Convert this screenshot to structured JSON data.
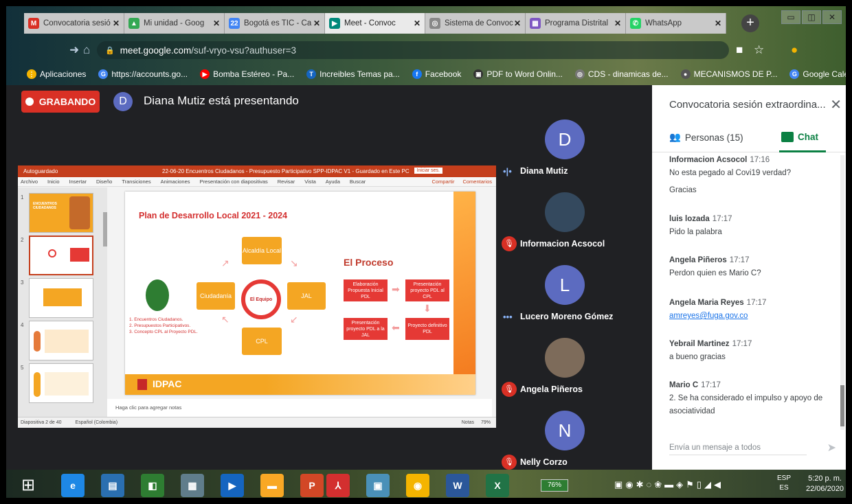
{
  "browser": {
    "tabs": [
      {
        "title": "Convocatoria sesió",
        "icon": "gmail-icon",
        "color": "#d93025",
        "glyph": "M"
      },
      {
        "title": "Mi unidad - Goog",
        "icon": "drive-icon",
        "color": "#34a853",
        "glyph": "▲"
      },
      {
        "title": "Bogotá es TIC - Ca",
        "icon": "calendar-icon",
        "color": "#4285f4",
        "glyph": "22"
      },
      {
        "title": "Meet - Convoc",
        "icon": "meet-icon",
        "color": "#00897b",
        "glyph": "▶"
      },
      {
        "title": "Sistema de Convoc",
        "icon": "globe-icon",
        "color": "#888888",
        "glyph": "◎"
      },
      {
        "title": "Programa Distrital",
        "icon": "calendar-icon",
        "color": "#7e57c2",
        "glyph": "▦"
      },
      {
        "title": "WhatsApp",
        "icon": "whatsapp-icon",
        "color": "#25d366",
        "glyph": "✆"
      }
    ],
    "url_host": "meet.google.com",
    "url_path": "/suf-vryo-vsu?authuser=3",
    "bookmarks": [
      {
        "label": "Aplicaciones",
        "color": "#f4b400",
        "glyph": "⋮"
      },
      {
        "label": "https://accounts.go...",
        "color": "#4285f4",
        "glyph": "G"
      },
      {
        "label": "Bomba Estéreo - Pa...",
        "color": "#ff0000",
        "glyph": "▶"
      },
      {
        "label": "Increibles Temas pa...",
        "color": "#1565c0",
        "glyph": "T"
      },
      {
        "label": "Facebook",
        "color": "#1877f2",
        "glyph": "f"
      },
      {
        "label": "PDF to Word Onlin...",
        "color": "#333333",
        "glyph": "▣"
      },
      {
        "label": "CDS - dinamicas de...",
        "color": "#777777",
        "glyph": "◎"
      },
      {
        "label": "MECANISMOS DE P...",
        "color": "#555555",
        "glyph": "●"
      },
      {
        "label": "Google Calendar",
        "color": "#4285f4",
        "glyph": "G"
      }
    ]
  },
  "meet": {
    "recording_label": "GRABANDO",
    "presenter_initial": "D",
    "presenter_text": "Diana Mutiz está presentando",
    "participants": [
      {
        "name": "Diana Mutiz",
        "initial": "D",
        "color": "#5c6bc0",
        "status": "speaking"
      },
      {
        "name": "Informacion Acsocol",
        "initial": "",
        "color": "#34495e",
        "status": "muted"
      },
      {
        "name": "Lucero Moreno Gómez",
        "initial": "L",
        "color": "#5c6bc0",
        "status": "speaking"
      },
      {
        "name": "Angela Piñeros",
        "initial": "",
        "color": "#7d6b5a",
        "status": "muted"
      },
      {
        "name": "Nelly Corzo",
        "initial": "N",
        "color": "#5c6bc0",
        "status": "muted"
      }
    ]
  },
  "ppt": {
    "autosave": "Autoguardado",
    "doc_title": "22-06-20 Encuentros Ciudadanos - Presupuesto Participativo SPP-IDPAC V1 - Guardado en Este PC",
    "share_label": "Iniciar ses.",
    "menu": [
      "Archivo",
      "Inicio",
      "Insertar",
      "Diseño",
      "Transiciones",
      "Animaciones",
      "Presentación con diapositivas",
      "Revisar",
      "Vista",
      "Ayuda",
      "Buscar"
    ],
    "menu_right": [
      "Compartir",
      "Comentarios"
    ],
    "thumb_numbers": [
      "1",
      "2",
      "3",
      "4",
      "5"
    ],
    "thumb1_text": "ENCUENTROS CIUDADANOS",
    "slide": {
      "title": "Plan de Desarrollo Local 2021 - 2024",
      "alcaldia": "Alcaldía Local",
      "ciudadania": "Ciudadanía",
      "jal": "JAL",
      "cpl": "CPL",
      "equipo": "El Equipo",
      "proceso": "El Proceso",
      "step1": "Elaboración Propuesta Inicial PDL",
      "step2": "Presentación proyecto PDL al CPL",
      "step3": "Proyecto definitivo PDL",
      "step4": "Presentación proyecto PDL a la JAL",
      "list": [
        "1. Encuentros Ciudadanos.",
        "2. Presupuestos Participativos.",
        "3. Concepto CPL al Proyecto PDL."
      ],
      "logo": "IDPAC"
    },
    "notes_placeholder": "Haga clic para agregar notas",
    "status_left": "Diapositiva 2 de 40",
    "status_lang": "Español (Colombia)",
    "status_notes": "Notas",
    "status_zoom": "79%"
  },
  "chat": {
    "title": "Convocatoria sesión extraordina...",
    "people_tab": "Personas (15)",
    "chat_tab": "Chat",
    "messages": [
      {
        "sender": "Informacion Acsocol",
        "time": "17:16",
        "lines": [
          "No esta pegado al Covi19 verdad?"
        ]
      },
      {
        "sender": "",
        "time": "",
        "lines": [
          "Gracias"
        ]
      },
      {
        "sender": "luis lozada",
        "time": "17:17",
        "lines": [
          "Pido la palabra"
        ]
      },
      {
        "sender": "Angela Piñeros",
        "time": "17:17",
        "lines": [
          "Perdon quien es Mario C?"
        ]
      },
      {
        "sender": "Angela Maria Reyes",
        "time": "17:17",
        "lines": [
          "amreyes@fuga.gov.co"
        ]
      },
      {
        "sender": "Yebrail Martinez",
        "time": "17:17",
        "lines": [
          "a bueno gracias"
        ]
      },
      {
        "sender": "Mario C",
        "time": "17:17",
        "lines": [
          "2. Se ha considerado el impulso y apoyo de",
          "asociatividad"
        ]
      }
    ],
    "input_placeholder": "Envía un mensaje a todos"
  },
  "taskbar": {
    "battery": "76%",
    "lang_top": "ESP",
    "lang_bottom": "ES",
    "time": "5:20 p. m.",
    "date": "22/06/2020",
    "apps": [
      {
        "name": "ie",
        "glyph": "e",
        "color": "#1e88e5"
      },
      {
        "name": "lenovo",
        "glyph": "▤",
        "color": "#2a6fb0"
      },
      {
        "name": "store",
        "glyph": "◧",
        "color": "#2e7d32"
      },
      {
        "name": "calculator",
        "glyph": "▦",
        "color": "#607d8b"
      },
      {
        "name": "media",
        "glyph": "▶",
        "color": "#1565c0"
      },
      {
        "name": "explorer",
        "glyph": "▬",
        "color": "#f9a825"
      },
      {
        "name": "powerpoint",
        "glyph": "P",
        "color": "#d24726"
      },
      {
        "name": "acrobat",
        "glyph": "⅄",
        "color": "#d32f2f"
      },
      {
        "name": "screen",
        "glyph": "▣",
        "color": "#4a90b8"
      },
      {
        "name": "chrome",
        "glyph": "◉",
        "color": "#f4b400"
      },
      {
        "name": "word",
        "glyph": "W",
        "color": "#2b579a"
      },
      {
        "name": "excel",
        "glyph": "X",
        "color": "#217346"
      }
    ]
  }
}
